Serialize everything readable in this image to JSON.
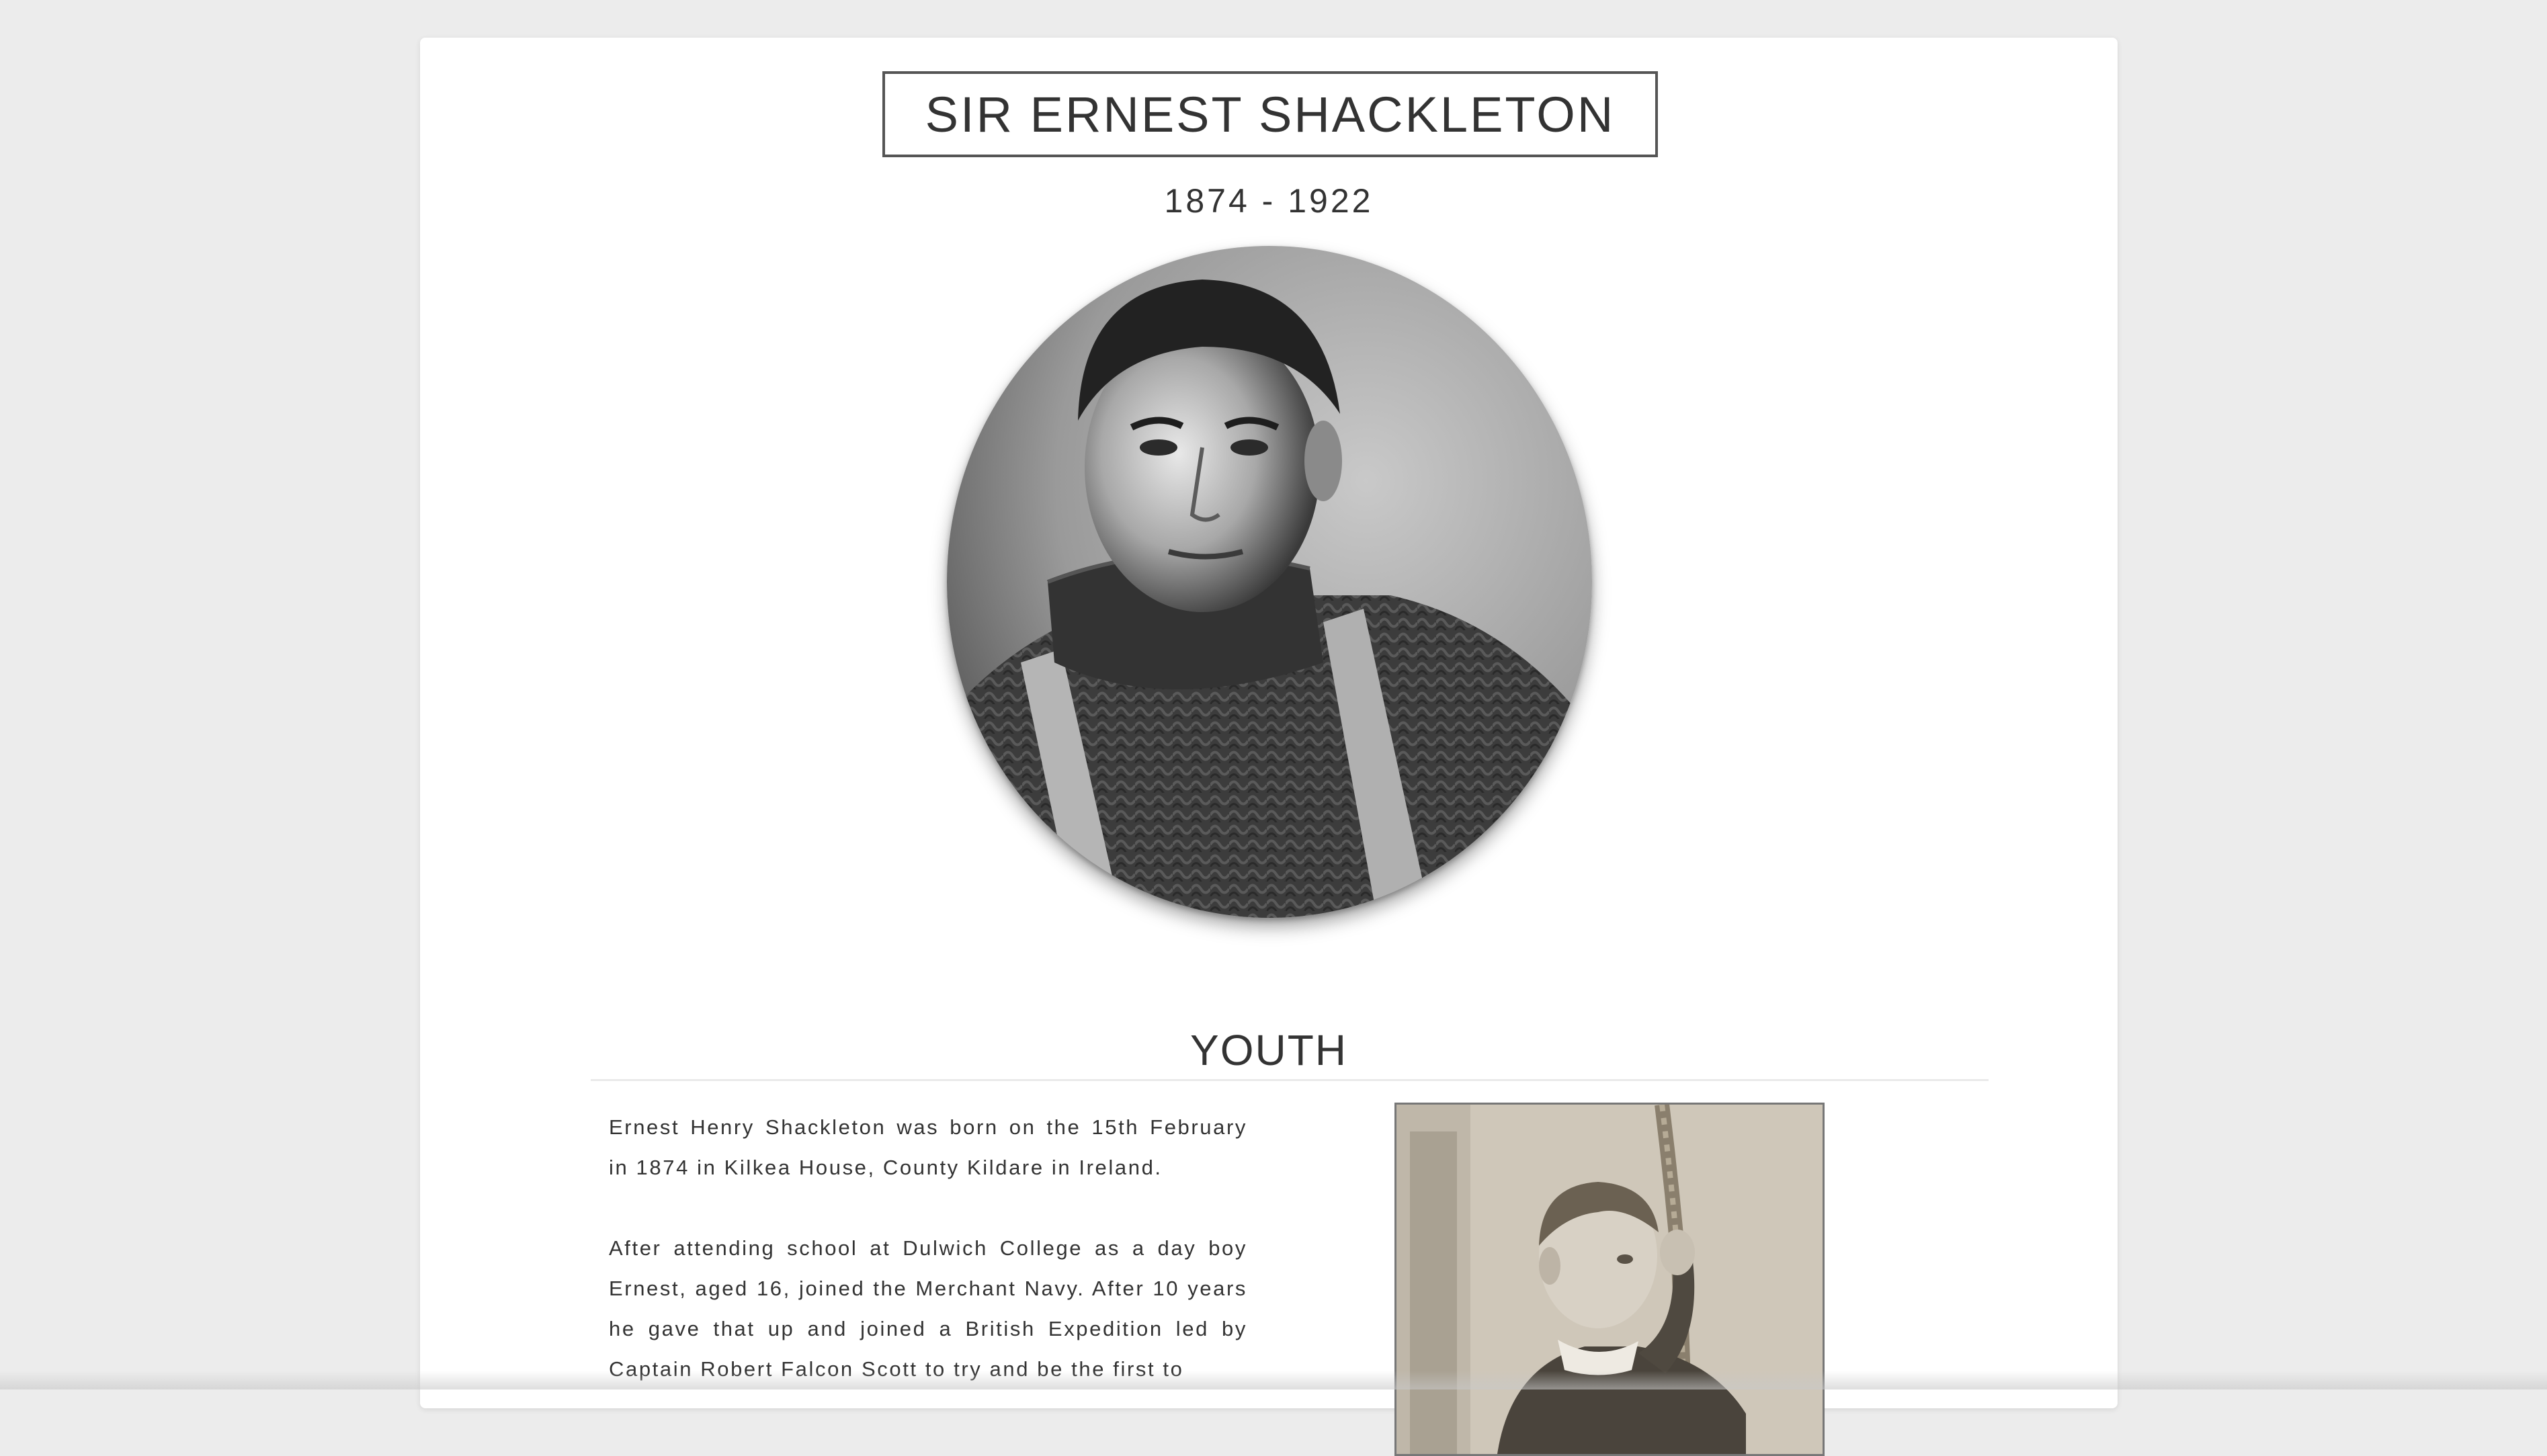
{
  "header": {
    "title": "SIR ERNEST SHACKLETON",
    "dates": "1874 - 1922"
  },
  "portrait": {
    "alt": "Portrait of Sir Ernest Shackleton"
  },
  "youth": {
    "heading": "YOUTH",
    "paragraphs": [
      "Ernest Henry Shackleton was born on the 15th February in 1874 in Kilkea House, County Kildare in Ireland.",
      "After attending school at Dulwich College as a day boy Ernest, aged 16, joined the Merchant Navy. After 10 years he gave that up and joined a British Expedition led by Captain Robert Falcon Scott to try and be the first to"
    ],
    "photo_alt": "Young Ernest Shackleton holding a rope"
  },
  "colors": {
    "page_background": "#ececec",
    "card_background": "#ffffff",
    "title_border": "#555555",
    "text": "#333333"
  }
}
